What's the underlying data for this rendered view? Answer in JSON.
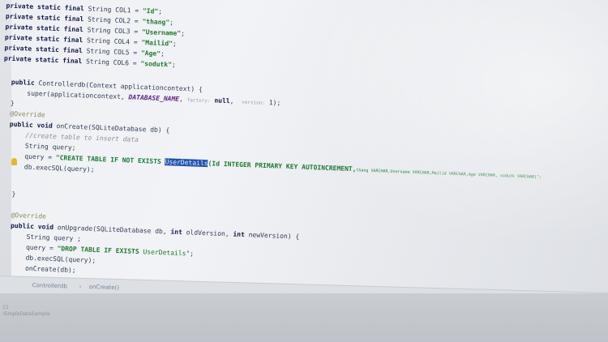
{
  "code": {
    "col1": {
      "mod": "private static final",
      "type": " String ",
      "name": "COL1",
      "eq": " = ",
      "val": "\"Id\"",
      "end": ";"
    },
    "col2": {
      "mod": "private static final",
      "type": " String ",
      "name": "COL2",
      "eq": " = ",
      "val": "\"thang\"",
      "end": ";"
    },
    "col3": {
      "mod": "private static final",
      "type": " String ",
      "name": "COL3",
      "eq": " = ",
      "val": "\"Username\"",
      "end": ";"
    },
    "col4": {
      "mod": "private static final",
      "type": " String ",
      "name": "COL4",
      "eq": " = ",
      "val": "\"Mailid\"",
      "end": ";"
    },
    "col5": {
      "mod": "private static final",
      "type": " String ",
      "name": "COL5",
      "eq": " = ",
      "val": "\"Age\"",
      "end": ";"
    },
    "col6": {
      "mod": "private static final",
      "type": " String ",
      "name": "COL6",
      "eq": " = ",
      "val": "\"sodutk\"",
      "end": ";"
    },
    "ctor_sig": {
      "kw": "public",
      "rest": " Controllerdb(Context applicationcontext) {"
    },
    "ctor_super": {
      "call": "super(applicationcontext, ",
      "const": "DATABASE_NAME",
      "sep": ", ",
      "hint_factory": "factory:",
      "null": " null",
      "sep2": ",  ",
      "hint_version": "version:",
      "ver": " 1);"
    },
    "brace1": "}",
    "override1": "@Override",
    "oncreate_sig": {
      "kw": "public void",
      "rest": " onCreate(SQLiteDatabase db) {"
    },
    "comment": "//create table to insert data",
    "string_query": "String query;",
    "query_line": {
      "pre": "query = ",
      "str1": "\"CREATE TABLE IF NOT EXISTS ",
      "selected": "UserDetails",
      "str2": "(Id INTEGER PRIMARY KEY AUTOINCREMENT,",
      "tail": "thang VARCHAR,Username VARCHAR,Mailid VARCHAR,Age VARCHAR, sodutk VARCHAR)\";"
    },
    "exec1": "db.execSQL(query);",
    "brace2": "}",
    "override2": "@Override",
    "onupgrade_sig": {
      "kw": "public void",
      "rest1": " onUpgrade(SQLiteDatabase db, ",
      "kw2": "int",
      "rest2": " oldVersion, ",
      "kw3": "int",
      "rest3": " newVersion) {"
    },
    "string_query2": "String query ;",
    "drop_line": {
      "pre": "query = ",
      "str": "\"DROP TABLE IF EXISTS ",
      "name": "UserDetails\"",
      "end": ";"
    },
    "exec2": "db.execSQL(query);",
    "oncreate_call": "onCreate(db);"
  },
  "breadcrumbs": {
    "cls": "Controllerdb",
    "sep": "›",
    "method": "onCreate()"
  },
  "bottom": {
    "line_num": "13",
    "tab": "SimpleDataSampla"
  }
}
